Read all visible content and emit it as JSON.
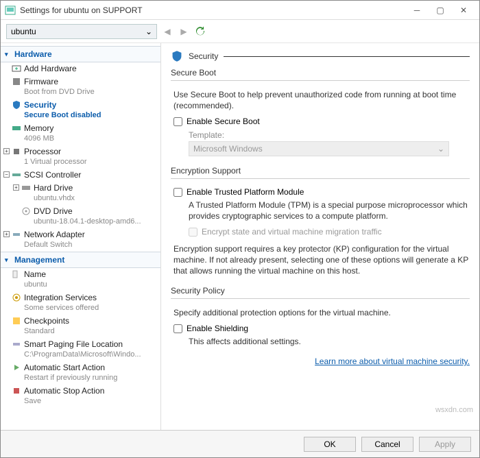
{
  "titlebar": {
    "title": "Settings for ubuntu on SUPPORT"
  },
  "toolbar": {
    "vm_name": "ubuntu"
  },
  "sidebar": {
    "hardware_label": "Hardware",
    "management_label": "Management",
    "add_hardware": "Add Hardware",
    "firmware": {
      "label": "Firmware",
      "sub": "Boot from DVD Drive"
    },
    "security": {
      "label": "Security",
      "sub": "Secure Boot disabled"
    },
    "memory": {
      "label": "Memory",
      "sub": "4096 MB"
    },
    "processor": {
      "label": "Processor",
      "sub": "1 Virtual processor"
    },
    "scsi": {
      "label": "SCSI Controller"
    },
    "harddrive": {
      "label": "Hard Drive",
      "sub": "ubuntu.vhdx"
    },
    "dvddrive": {
      "label": "DVD Drive",
      "sub": "ubuntu-18.04.1-desktop-amd6..."
    },
    "network": {
      "label": "Network Adapter",
      "sub": "Default Switch"
    },
    "name": {
      "label": "Name",
      "sub": "ubuntu"
    },
    "integration": {
      "label": "Integration Services",
      "sub": "Some services offered"
    },
    "checkpoints": {
      "label": "Checkpoints",
      "sub": "Standard"
    },
    "paging": {
      "label": "Smart Paging File Location",
      "sub": "C:\\ProgramData\\Microsoft\\Windo..."
    },
    "autostart": {
      "label": "Automatic Start Action",
      "sub": "Restart if previously running"
    },
    "autostop": {
      "label": "Automatic Stop Action",
      "sub": "Save"
    }
  },
  "content": {
    "page_title": "Security",
    "secure_boot": {
      "group": "Secure Boot",
      "desc": "Use Secure Boot to help prevent unauthorized code from running at boot time (recommended).",
      "checkbox": "Enable Secure Boot",
      "template_label": "Template:",
      "template_value": "Microsoft Windows"
    },
    "encryption": {
      "group": "Encryption Support",
      "checkbox": "Enable Trusted Platform Module",
      "desc": "A Trusted Platform Module (TPM) is a special purpose microprocessor which provides cryptographic services to a compute platform.",
      "encrypt_cb": "Encrypt state and virtual machine migration traffic",
      "note": "Encryption support requires a key protector (KP) configuration for the virtual machine. If not already present, selecting one of these options will generate a KP that allows running the virtual machine on this host."
    },
    "policy": {
      "group": "Security Policy",
      "desc": "Specify additional protection options for the virtual machine.",
      "checkbox": "Enable Shielding",
      "note": "This affects additional settings."
    },
    "link": "Learn more about virtual machine security."
  },
  "footer": {
    "ok": "OK",
    "cancel": "Cancel",
    "apply": "Apply"
  },
  "watermark": "wsxdn.com"
}
